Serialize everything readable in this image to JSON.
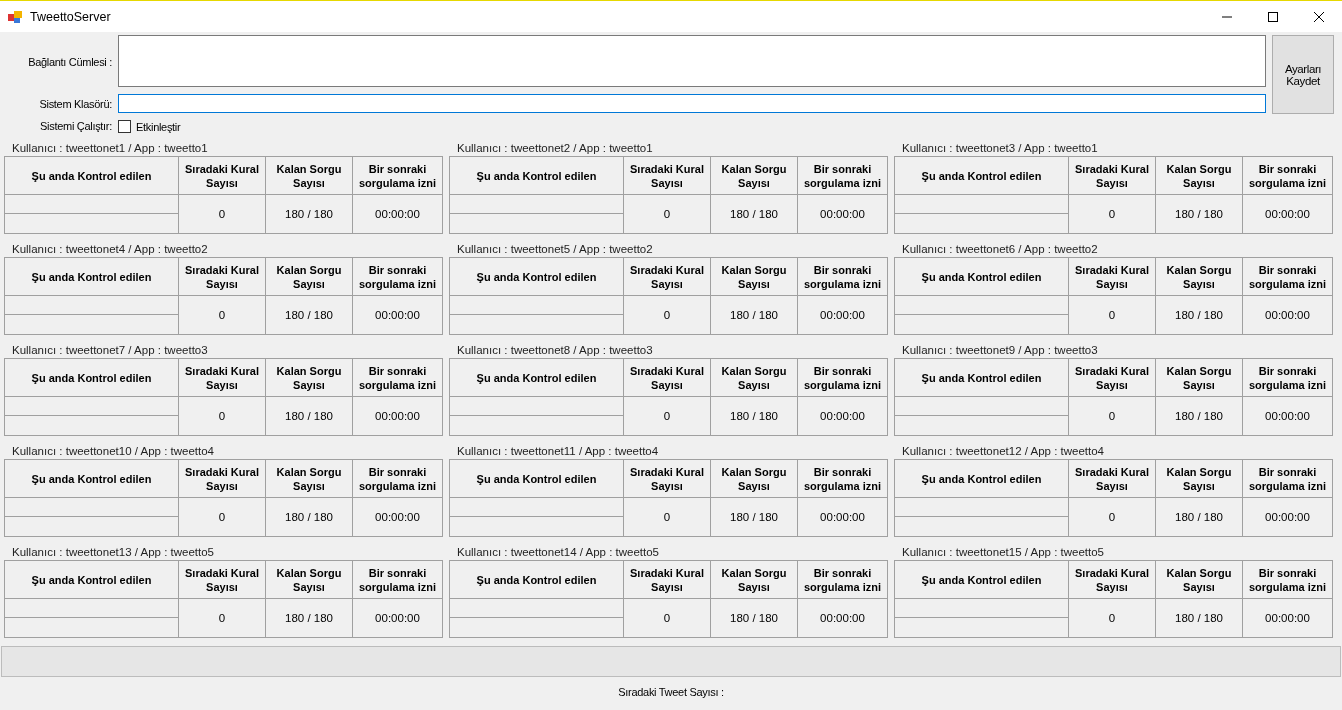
{
  "window": {
    "title": "TweettoServer"
  },
  "form": {
    "connection_label": "Bağlantı Cümlesi :",
    "folder_label": "Sistem Klasörü:",
    "run_label": "Sistemi Çalıştır:",
    "enable_checkbox": {
      "label": "Etkinleştir",
      "checked": false
    },
    "save_button": "Ayarları\nKaydet"
  },
  "groups": [
    {
      "title": "Kullanıcı : tweettonet1 / App : tweetto1",
      "headers": [
        "Şu anda Kontrol edilen",
        "Sıradaki Kural Sayısı",
        "Kalan Sorgu Sayısı",
        "Bir sonraki sorgulama izni"
      ],
      "rule_count": "0",
      "remaining": "180 / 180",
      "next_permit": "00:00:00"
    },
    {
      "title": "Kullanıcı : tweettonet2 / App : tweetto1",
      "headers": [
        "Şu anda Kontrol edilen",
        "Sıradaki Kural Sayısı",
        "Kalan Sorgu Sayısı",
        "Bir sonraki sorgulama izni"
      ],
      "rule_count": "0",
      "remaining": "180 / 180",
      "next_permit": "00:00:00"
    },
    {
      "title": "Kullanıcı : tweettonet3 / App : tweetto1",
      "headers": [
        "Şu anda Kontrol edilen",
        "Sıradaki Kural Sayısı",
        "Kalan Sorgu Sayısı",
        "Bir sonraki sorgulama izni"
      ],
      "rule_count": "0",
      "remaining": "180 / 180",
      "next_permit": "00:00:00"
    },
    {
      "title": "Kullanıcı : tweettonet4 / App : tweetto2",
      "headers": [
        "Şu anda Kontrol edilen",
        "Sıradaki Kural Sayısı",
        "Kalan Sorgu Sayısı",
        "Bir sonraki sorgulama izni"
      ],
      "rule_count": "0",
      "remaining": "180 / 180",
      "next_permit": "00:00:00"
    },
    {
      "title": "Kullanıcı : tweettonet5 / App : tweetto2",
      "headers": [
        "Şu anda Kontrol edilen",
        "Sıradaki Kural Sayısı",
        "Kalan Sorgu Sayısı",
        "Bir sonraki sorgulama izni"
      ],
      "rule_count": "0",
      "remaining": "180 / 180",
      "next_permit": "00:00:00"
    },
    {
      "title": "Kullanıcı : tweettonet6 / App : tweetto2",
      "headers": [
        "Şu anda Kontrol edilen",
        "Sıradaki Kural Sayısı",
        "Kalan Sorgu Sayısı",
        "Bir sonraki sorgulama izni"
      ],
      "rule_count": "0",
      "remaining": "180 / 180",
      "next_permit": "00:00:00"
    },
    {
      "title": "Kullanıcı : tweettonet7 / App : tweetto3",
      "headers": [
        "Şu anda Kontrol edilen",
        "Sıradaki Kural Sayısı",
        "Kalan Sorgu Sayısı",
        "Bir sonraki sorgulama izni"
      ],
      "rule_count": "0",
      "remaining": "180 / 180",
      "next_permit": "00:00:00"
    },
    {
      "title": "Kullanıcı : tweettonet8 / App : tweetto3",
      "headers": [
        "Şu anda Kontrol edilen",
        "Sıradaki Kural Sayısı",
        "Kalan Sorgu Sayısı",
        "Bir sonraki sorgulama izni"
      ],
      "rule_count": "0",
      "remaining": "180 / 180",
      "next_permit": "00:00:00"
    },
    {
      "title": "Kullanıcı : tweettonet9 / App : tweetto3",
      "headers": [
        "Şu anda Kontrol edilen",
        "Sıradaki Kural Sayısı",
        "Kalan Sorgu Sayısı",
        "Bir sonraki sorgulama izni"
      ],
      "rule_count": "0",
      "remaining": "180 / 180",
      "next_permit": "00:00:00"
    },
    {
      "title": "Kullanıcı : tweettonet10 / App : tweetto4",
      "headers": [
        "Şu anda Kontrol edilen",
        "Sıradaki Kural Sayısı",
        "Kalan Sorgu Sayısı",
        "Bir sonraki sorgulama izni"
      ],
      "rule_count": "0",
      "remaining": "180 / 180",
      "next_permit": "00:00:00"
    },
    {
      "title": "Kullanıcı : tweettonet11 / App : tweetto4",
      "headers": [
        "Şu anda Kontrol edilen",
        "Sıradaki Kural Sayısı",
        "Kalan Sorgu Sayısı",
        "Bir sonraki sorgulama izni"
      ],
      "rule_count": "0",
      "remaining": "180 / 180",
      "next_permit": "00:00:00"
    },
    {
      "title": "Kullanıcı : tweettonet12 / App : tweetto4",
      "headers": [
        "Şu anda Kontrol edilen",
        "Sıradaki Kural Sayısı",
        "Kalan Sorgu Sayısı",
        "Bir sonraki sorgulama izni"
      ],
      "rule_count": "0",
      "remaining": "180 / 180",
      "next_permit": "00:00:00"
    },
    {
      "title": "Kullanıcı : tweettonet13 / App : tweetto5",
      "headers": [
        "Şu anda Kontrol edilen",
        "Sıradaki Kural Sayısı",
        "Kalan Sorgu Sayısı",
        "Bir sonraki sorgulama izni"
      ],
      "rule_count": "0",
      "remaining": "180 / 180",
      "next_permit": "00:00:00"
    },
    {
      "title": "Kullanıcı : tweettonet14 / App : tweetto5",
      "headers": [
        "Şu anda Kontrol edilen",
        "Sıradaki Kural Sayısı",
        "Kalan Sorgu Sayısı",
        "Bir sonraki sorgulama izni"
      ],
      "rule_count": "0",
      "remaining": "180 / 180",
      "next_permit": "00:00:00"
    },
    {
      "title": "Kullanıcı : tweettonet15 / App : tweetto5",
      "headers": [
        "Şu anda Kontrol edilen",
        "Sıradaki Kural Sayısı",
        "Kalan Sorgu Sayısı",
        "Bir sonraki sorgulama izni"
      ],
      "rule_count": "0",
      "remaining": "180 / 180",
      "next_permit": "00:00:00"
    }
  ],
  "progress": {
    "level": 0
  },
  "footer": {
    "tweet_count_label": "Sıradaki Tweet Sayısı :"
  }
}
